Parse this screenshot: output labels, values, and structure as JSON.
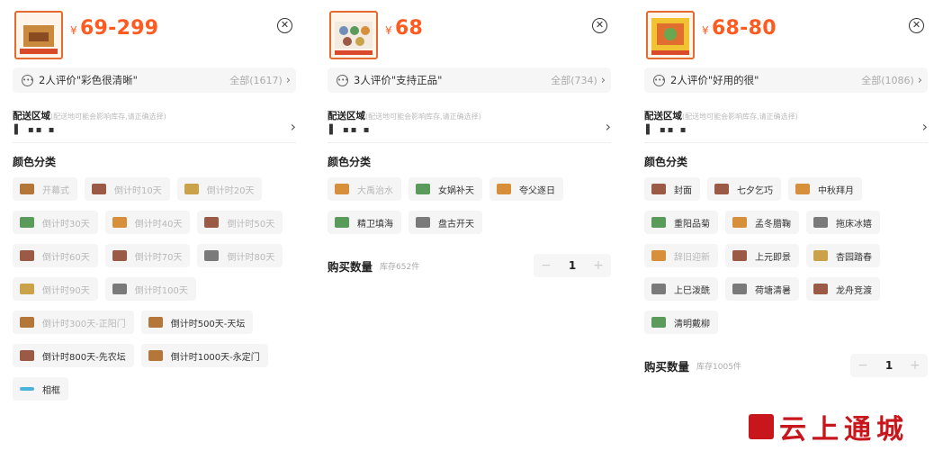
{
  "panels": [
    {
      "price_symbol": "¥",
      "price": "69-299",
      "review_text": "2人评价\"彩色很清晰\"",
      "review_all": "全部(1617)",
      "delivery_label": "配送区域",
      "delivery_note": "(配送地可能会影响库存,请正确选择)",
      "address": "▌ ▪▪ ▪",
      "section_title": "颜色分类",
      "options": [
        {
          "label": "开幕式",
          "enabled": false,
          "icon": "a"
        },
        {
          "label": "倒计时10天",
          "enabled": false,
          "icon": "b"
        },
        {
          "label": "倒计时20天",
          "enabled": false,
          "icon": "c"
        },
        {
          "label": "倒计时30天",
          "enabled": false,
          "icon": "e"
        },
        {
          "label": "倒计时40天",
          "enabled": false,
          "icon": "f"
        },
        {
          "label": "倒计时50天",
          "enabled": false,
          "icon": "b"
        },
        {
          "label": "倒计时60天",
          "enabled": false,
          "icon": "b"
        },
        {
          "label": "倒计时70天",
          "enabled": false,
          "icon": "b"
        },
        {
          "label": "倒计时80天",
          "enabled": false,
          "icon": "g"
        },
        {
          "label": "倒计时90天",
          "enabled": false,
          "icon": "c"
        },
        {
          "label": "倒计时100天",
          "enabled": false,
          "icon": "g"
        },
        {
          "label": "倒计时300天-正阳门",
          "enabled": false,
          "icon": "a"
        },
        {
          "label": "倒计时500天-天坛",
          "enabled": true,
          "icon": "a"
        },
        {
          "label": "倒计时800天-先农坛",
          "enabled": true,
          "icon": "b"
        },
        {
          "label": "倒计时1000天-永定门",
          "enabled": true,
          "icon": "a"
        },
        {
          "label": "相框",
          "enabled": true,
          "icon": "h"
        }
      ]
    },
    {
      "price_symbol": "¥",
      "price": "68",
      "review_text": "3人评价\"支持正品\"",
      "review_all": "全部(734)",
      "delivery_label": "配送区域",
      "delivery_note": "(配送地可能会影响库存,请正确选择)",
      "address": "▌ ▪▪ ▪",
      "section_title": "颜色分类",
      "options": [
        {
          "label": "大禹治水",
          "enabled": false,
          "icon": "f"
        },
        {
          "label": "女娲补天",
          "enabled": true,
          "icon": "e"
        },
        {
          "label": "夸父逐日",
          "enabled": true,
          "icon": "f"
        },
        {
          "label": "精卫填海",
          "enabled": true,
          "icon": "e"
        },
        {
          "label": "盘古开天",
          "enabled": true,
          "icon": "g"
        }
      ],
      "qty_label": "购买数量",
      "stock": "库存652件",
      "minus": "−",
      "quantity": "1",
      "plus": "+"
    },
    {
      "price_symbol": "¥",
      "price": "68-80",
      "review_text": "2人评价\"好用的很\"",
      "review_all": "全部(1086)",
      "delivery_label": "配送区域",
      "delivery_note": "(配送地可能会影响库存,请正确选择)",
      "address": "▌ ▪▪ ▪",
      "section_title": "颜色分类",
      "options": [
        {
          "label": "封面",
          "enabled": true,
          "icon": "b"
        },
        {
          "label": "七夕乞巧",
          "enabled": true,
          "icon": "b"
        },
        {
          "label": "中秋拜月",
          "enabled": true,
          "icon": "f"
        },
        {
          "label": "重阳品菊",
          "enabled": true,
          "icon": "e"
        },
        {
          "label": "孟冬腊鞠",
          "enabled": true,
          "icon": "f"
        },
        {
          "label": "拖床冰嬉",
          "enabled": true,
          "icon": "g"
        },
        {
          "label": "辞旧迎新",
          "enabled": false,
          "icon": "f"
        },
        {
          "label": "上元即景",
          "enabled": true,
          "icon": "b"
        },
        {
          "label": "杏园踏春",
          "enabled": true,
          "icon": "c"
        },
        {
          "label": "上巳泼酰",
          "enabled": true,
          "icon": "g"
        },
        {
          "label": "荷塘清暑",
          "enabled": true,
          "icon": "g"
        },
        {
          "label": "龙舟竞渡",
          "enabled": true,
          "icon": "b"
        },
        {
          "label": "清明戴柳",
          "enabled": true,
          "icon": "e"
        }
      ],
      "qty_label": "购买数量",
      "stock": "库存1005件",
      "minus": "−",
      "quantity": "1",
      "plus": "+"
    }
  ],
  "brand": {
    "name": "云上通城"
  },
  "icons": {
    "close": "close-icon",
    "review": "review-bubble-icon",
    "arrow": "chevron-right-icon"
  },
  "colors": {
    "price": "#ff5a1f",
    "brand": "#c8161d",
    "chip_bg": "#f5f5f5",
    "disabled_text": "#b8b8b8"
  }
}
